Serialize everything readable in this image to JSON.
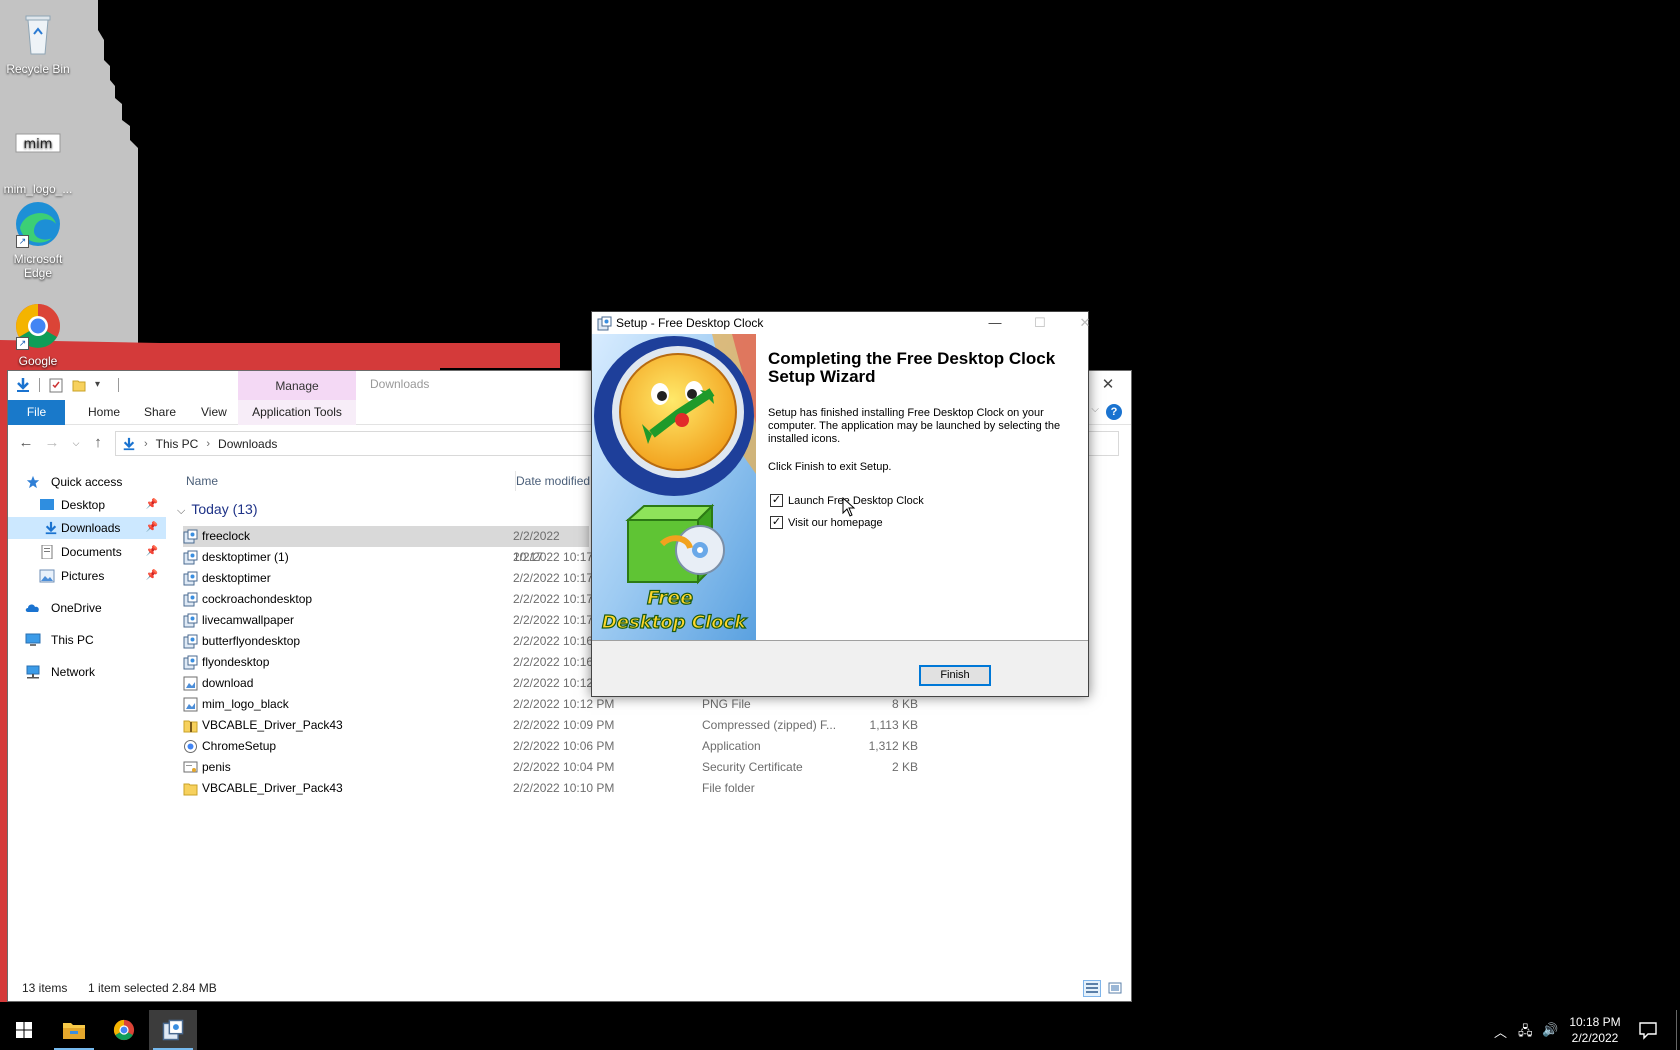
{
  "desktop": {
    "icons": [
      {
        "label": "Recycle Bin"
      },
      {
        "label": "mim_logo_..."
      },
      {
        "label": "Microsoft Edge"
      },
      {
        "label": "Google"
      }
    ]
  },
  "explorer": {
    "contextual_tab": "Manage",
    "window_title": "Downloads",
    "ribbon_tabs": [
      "File",
      "Home",
      "Share",
      "View",
      "Application Tools"
    ],
    "breadcrumb": [
      "This PC",
      "Downloads"
    ],
    "nav": {
      "quick_access": "Quick access",
      "desktop": "Desktop",
      "downloads": "Downloads",
      "documents": "Documents",
      "pictures": "Pictures",
      "onedrive": "OneDrive",
      "this_pc": "This PC",
      "network": "Network"
    },
    "columns": {
      "name": "Name",
      "date": "Date modified"
    },
    "group": "Today (13)",
    "files": [
      {
        "name": "freeclock",
        "date": "2/2/2022 10:17",
        "type": "",
        "size": "",
        "icon": "setup-icon"
      },
      {
        "name": "desktoptimer (1)",
        "date": "2/2/2022 10:17",
        "type": "",
        "size": "",
        "icon": "setup-icon"
      },
      {
        "name": "desktoptimer",
        "date": "2/2/2022 10:17",
        "type": "",
        "size": "",
        "icon": "setup-icon"
      },
      {
        "name": "cockroachondesktop",
        "date": "2/2/2022 10:17",
        "type": "",
        "size": "",
        "icon": "setup-icon"
      },
      {
        "name": "livecamwallpaper",
        "date": "2/2/2022 10:17",
        "type": "",
        "size": "",
        "icon": "setup-icon"
      },
      {
        "name": "butterflyondesktop",
        "date": "2/2/2022 10:16",
        "type": "",
        "size": "",
        "icon": "setup-icon"
      },
      {
        "name": "flyondesktop",
        "date": "2/2/2022 10:16",
        "type": "",
        "size": "",
        "icon": "setup-icon"
      },
      {
        "name": "download",
        "date": "2/2/2022 10:12",
        "type": "",
        "size": "",
        "icon": "image-icon"
      },
      {
        "name": "mim_logo_black",
        "date": "2/2/2022 10:12 PM",
        "type": "PNG File",
        "size": "8 KB",
        "icon": "image-icon"
      },
      {
        "name": "VBCABLE_Driver_Pack43",
        "date": "2/2/2022 10:09 PM",
        "type": "Compressed (zipped) F...",
        "size": "1,113 KB",
        "icon": "zip-icon"
      },
      {
        "name": "ChromeSetup",
        "date": "2/2/2022 10:06 PM",
        "type": "Application",
        "size": "1,312 KB",
        "icon": "app-icon"
      },
      {
        "name": "penis",
        "date": "2/2/2022 10:04 PM",
        "type": "Security Certificate",
        "size": "2 KB",
        "icon": "certificate-icon"
      },
      {
        "name": "VBCABLE_Driver_Pack43",
        "date": "2/2/2022 10:10 PM",
        "type": "File folder",
        "size": "",
        "icon": "folder-icon"
      }
    ],
    "status": {
      "count": "13 items",
      "selected": "1 item selected  2.84 MB"
    }
  },
  "setup": {
    "title": "Setup - Free Desktop Clock",
    "heading": "Completing the Free Desktop Clock Setup Wizard",
    "body": "Setup has finished installing Free Desktop Clock on your computer. The application may be launched by selecting the installed icons.",
    "body2": "Click Finish to exit Setup.",
    "check_launch": "Launch Free Desktop Clock",
    "check_homepage": "Visit our homepage",
    "finish": "Finish",
    "banner_line1": "Free",
    "banner_line2": "Desktop Clock"
  },
  "taskbar": {
    "time": "10:18 PM",
    "date": "2/2/2022"
  }
}
